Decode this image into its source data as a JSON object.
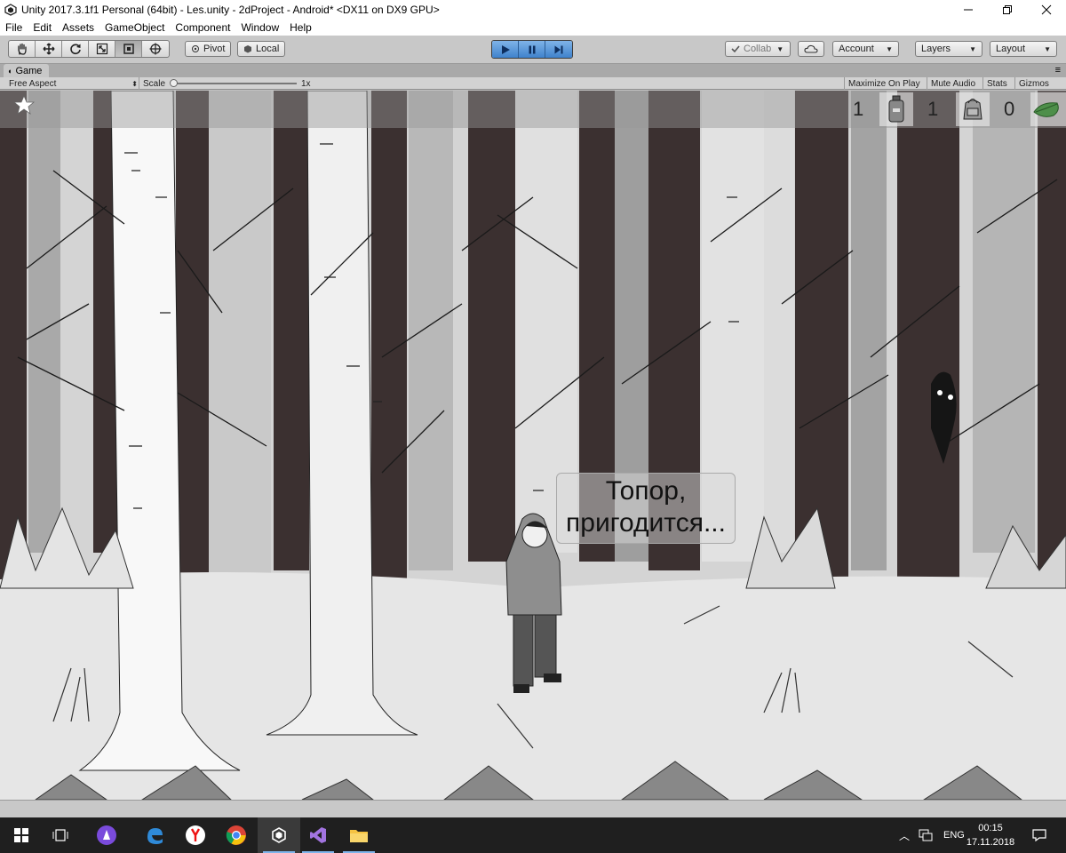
{
  "window": {
    "title": "Unity 2017.3.1f1 Personal (64bit) - Les.unity - 2dProject - Android* <DX11 on DX9 GPU>"
  },
  "menu": [
    "File",
    "Edit",
    "Assets",
    "GameObject",
    "Component",
    "Window",
    "Help"
  ],
  "toolbar": {
    "pivot_label": "Pivot",
    "local_label": "Local",
    "collab_label": "Collab",
    "account_label": "Account",
    "layers_label": "Layers",
    "layout_label": "Layout"
  },
  "panel": {
    "tab_label": "Game",
    "aspect_label": "Free Aspect",
    "scale_label": "Scale",
    "scale_value": "1x",
    "maximize_label": "Maximize On Play",
    "mute_label": "Mute Audio",
    "stats_label": "Stats",
    "gizmos_label": "Gizmos"
  },
  "hud": {
    "counts": [
      "1",
      "1",
      "0"
    ],
    "item_icons": [
      "gas-canister-icon",
      "backpack-icon",
      "green-leaf-icon"
    ]
  },
  "dialog": {
    "line1": "Топор,",
    "line2": "пригодится..."
  },
  "taskbar": {
    "language": "ENG",
    "time": "00:15",
    "date": "17.11.2018"
  },
  "colors": {
    "play_accent": "#4a8fd6",
    "taskbar_bg": "#1f1f1f",
    "toolbar_bg": "#c8c8c8"
  }
}
